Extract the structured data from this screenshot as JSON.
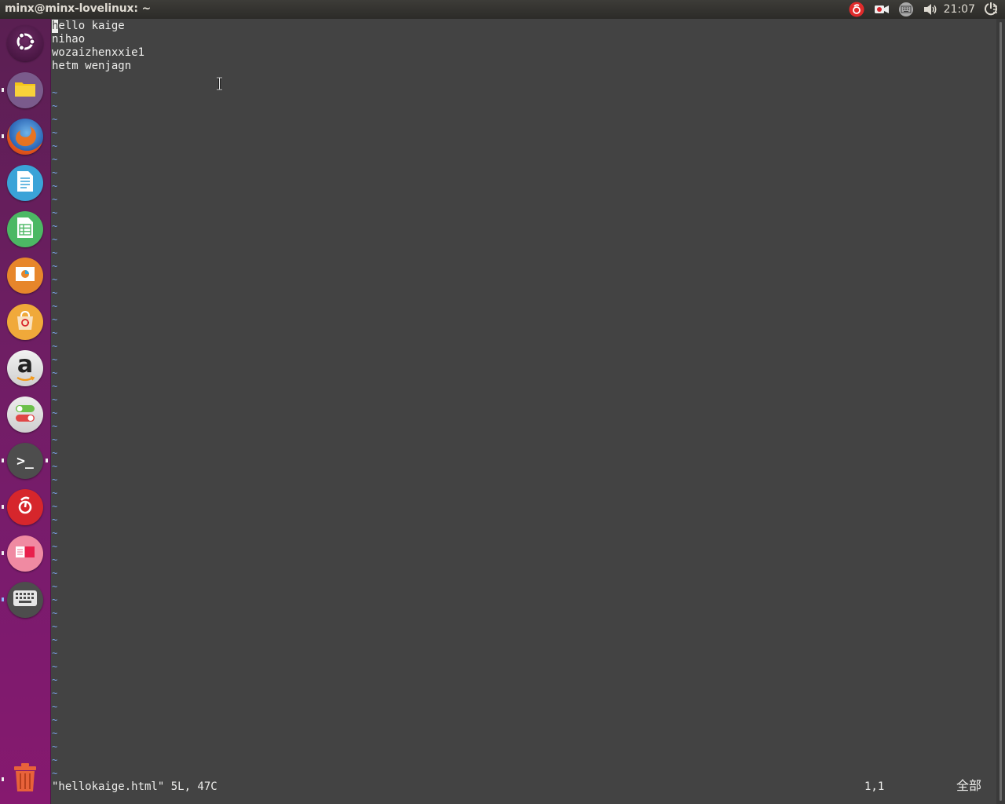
{
  "window": {
    "title": "minx@minx-lovelinux: ~"
  },
  "tray": {
    "clock": "21:07"
  },
  "launcher": {
    "items": [
      {
        "name": "ubuntu-dash",
        "icon": "ubuntu-logo-icon"
      },
      {
        "name": "files",
        "icon": "folder-icon"
      },
      {
        "name": "firefox",
        "icon": "firefox-icon"
      },
      {
        "name": "libreoffice-writer",
        "icon": "writer-doc-icon"
      },
      {
        "name": "libreoffice-calc",
        "icon": "calc-sheet-icon"
      },
      {
        "name": "libreoffice-impress",
        "icon": "impress-slide-icon"
      },
      {
        "name": "software-center",
        "icon": "shopping-bag-icon"
      },
      {
        "name": "amazon",
        "icon": "amazon-a-icon"
      },
      {
        "name": "system-settings",
        "icon": "toggle-switches-icon"
      },
      {
        "name": "terminal",
        "icon": "terminal-prompt-icon",
        "prompt": ">_"
      },
      {
        "name": "netease-music",
        "icon": "netease-music-icon"
      },
      {
        "name": "screen-recorder",
        "icon": "recorder-icon"
      },
      {
        "name": "on-screen-keyboard",
        "icon": "keyboard-icon"
      },
      {
        "name": "trash",
        "icon": "trash-icon"
      }
    ],
    "amazon_glyph": "a"
  },
  "editor": {
    "lines": [
      "hello kaige",
      "nihao",
      "wozaizhenxxie1",
      "hetm wenjagn"
    ],
    "tilde": "~",
    "status": {
      "file": "\"hellokaige.html\" 5L, 47C",
      "position": "1,1",
      "scroll": "全部"
    }
  },
  "colors": {
    "launcher_top": "#5a1f52",
    "launcher_bottom": "#86196f",
    "terminal_bg": "#434343",
    "tilde": "#7aa3e8",
    "text": "#eeeeec"
  }
}
